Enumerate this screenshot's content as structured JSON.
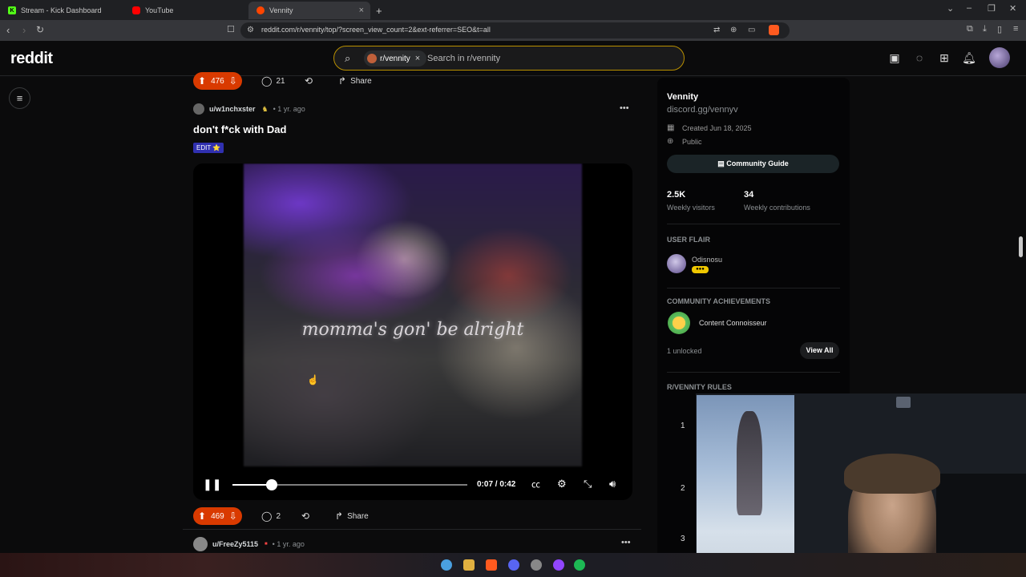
{
  "browser": {
    "tabs": [
      {
        "label": "Stream - Kick Dashboard",
        "icon": "kick-icon",
        "color": "#53fc18"
      },
      {
        "label": "YouTube",
        "icon": "youtube-icon",
        "color": "#ff0000"
      },
      {
        "label": "Vennity",
        "icon": "reddit-icon",
        "color": "#ff4500"
      }
    ],
    "new_tab": "+",
    "url": "reddit.com/r/vennity/top/?screen_view_count=2&ext-referrer=SEO&t=all"
  },
  "header": {
    "logo": "reddit",
    "search_chip": "r/vennity",
    "search_placeholder": "Search in r/vennity"
  },
  "feed": {
    "prev_post": {
      "votes": "476",
      "comments": "21",
      "share": "Share"
    },
    "post": {
      "author": "u/w1nchxster",
      "time": "• 1 yr. ago",
      "title": "don't f*ck with Dad",
      "flair": "EDIT ⭐",
      "video": {
        "caption": "momma's gon' be alright",
        "time": "0:07 / 0:42",
        "progress": 0.167
      },
      "votes": "469",
      "comments": "2",
      "share": "Share"
    },
    "next_post": {
      "author": "u/FreeZy5115",
      "time": "• 1 yr. ago"
    }
  },
  "sidebar": {
    "name": "Vennity",
    "description": "discord.gg/vennyv",
    "created": "Created Jun 18, 2025",
    "visibility": "Public",
    "guide_button": "Community Guide",
    "stats": [
      {
        "value": "2.5K",
        "label": "Weekly visitors"
      },
      {
        "value": "34",
        "label": "Weekly contributions"
      }
    ],
    "user_flair_heading": "USER FLAIR",
    "flair_name": "Odisnosu",
    "achievements_heading": "COMMUNITY ACHIEVEMENTS",
    "achievement": "Content Connoisseur",
    "unlocked": "1 unlocked",
    "view_all": "View All",
    "rules_heading": "R/VENNITY RULES",
    "rules": [
      "1",
      "2",
      "3"
    ]
  },
  "colors": {
    "accent_upvote": "#d93a00",
    "search_border": "#b88f00",
    "flair_bg": "#3030b0"
  }
}
